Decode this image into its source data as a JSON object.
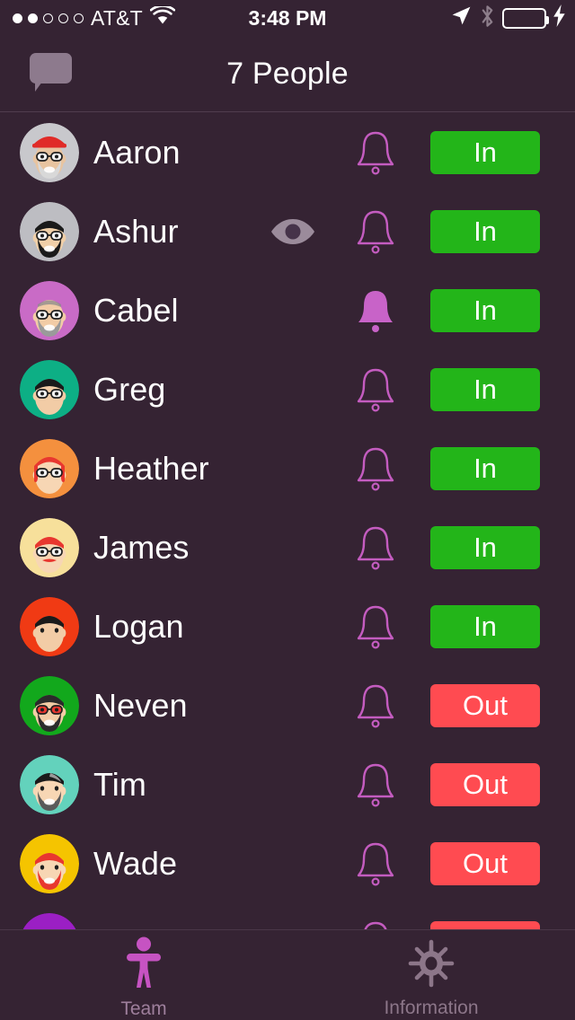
{
  "status_bar": {
    "carrier": "AT&T",
    "signal_dots_total": 5,
    "signal_dots_filled": 2,
    "wifi_icon": "wifi-icon",
    "time": "3:48 PM",
    "location_icon": "location-arrow-icon",
    "bluetooth_icon": "bluetooth-icon",
    "battery_icon": "battery-full-icon",
    "battery_color": "#4CD760",
    "charging_icon": "lightning-bolt-icon"
  },
  "nav_bar": {
    "title": "7 People",
    "left_button_icon": "chat-bubble-icon",
    "left_button_color": "#8D7A8D"
  },
  "colors": {
    "background": "#352333",
    "in_green": "#23B519",
    "out_red": "#FF4B51",
    "bell_magenta": "#C45CC0",
    "bell_filled": "#C863C8",
    "eye_gray": "#9B8B9B",
    "accent": "#C653C2",
    "inactive_tab": "#8C7689"
  },
  "list": {
    "status_in_label": "In",
    "status_out_label": "Out",
    "people": [
      {
        "name": "Aaron",
        "status": "In",
        "bell": "outline",
        "watching": false,
        "avatar": {
          "bg": "#C8C8CC",
          "hair": "#E02B28",
          "hair_style": "cap",
          "skin": "#E8C4A0",
          "beard": "#D8D8D8",
          "glasses": true
        }
      },
      {
        "name": "Ashur",
        "status": "In",
        "bell": "outline",
        "watching": true,
        "avatar": {
          "bg": "#BDBDC2",
          "hair": "#1A1A1A",
          "hair_style": "short",
          "skin": "#F0CFA8",
          "beard": "#1A1A1A",
          "glasses": true
        }
      },
      {
        "name": "Cabel",
        "status": "In",
        "bell": "filled",
        "watching": false,
        "avatar": {
          "bg": "#C96BC6",
          "hair": "#8A8A8A",
          "hair_style": "bald",
          "skin": "#F2CCA6",
          "beard": "#9A9A9A",
          "glasses": true
        }
      },
      {
        "name": "Greg",
        "status": "In",
        "bell": "outline",
        "watching": false,
        "avatar": {
          "bg": "#0DAF85",
          "hair": "#1A1A1A",
          "hair_style": "short",
          "skin": "#F2CCA6",
          "beard": "none",
          "glasses": true
        }
      },
      {
        "name": "Heather",
        "status": "In",
        "bell": "outline",
        "watching": false,
        "avatar": {
          "bg": "#F4903E",
          "hair": "#E8372F",
          "hair_style": "long",
          "skin": "#F7D6B4",
          "beard": "none",
          "glasses": true
        }
      },
      {
        "name": "James",
        "status": "In",
        "bell": "outline",
        "watching": false,
        "avatar": {
          "bg": "#F7E09B",
          "hair": "#E8372F",
          "hair_style": "short",
          "skin": "#F7D6B4",
          "beard": "mustache",
          "glasses": true
        }
      },
      {
        "name": "Logan",
        "status": "In",
        "bell": "outline",
        "watching": false,
        "avatar": {
          "bg": "#F03A14",
          "hair": "#1A1A1A",
          "hair_style": "short",
          "skin": "#F2CCA6",
          "beard": "none",
          "glasses": false
        }
      },
      {
        "name": "Neven",
        "status": "Out",
        "bell": "outline",
        "watching": false,
        "avatar": {
          "bg": "#12A81C",
          "hair": "#2B2B2B",
          "hair_style": "short",
          "skin": "#F2CCA6",
          "beard": "#2B2B2B",
          "glasses": true,
          "glasses_color": "#E8372F"
        }
      },
      {
        "name": "Tim",
        "status": "Out",
        "bell": "outline",
        "watching": false,
        "avatar": {
          "bg": "#63D2BC",
          "hair": "#1A1A1A",
          "hair_style": "streak",
          "skin": "#F7D6B4",
          "beard": "#5A5A5A",
          "glasses": false
        }
      },
      {
        "name": "Wade",
        "status": "Out",
        "bell": "outline",
        "watching": false,
        "avatar": {
          "bg": "#F5C400",
          "hair": "#E8372F",
          "hair_style": "short",
          "skin": "#F7D6B4",
          "beard": "#E8372F",
          "glasses": false
        }
      },
      {
        "name": "",
        "status": "Out",
        "bell": "outline",
        "watching": false,
        "partial": true,
        "avatar": {
          "bg": "#9B1FC4",
          "hair": "#E02B28",
          "hair_style": "short",
          "skin": "#F7D6B4",
          "beard": "none",
          "glasses": false
        }
      }
    ]
  },
  "tab_bar": {
    "tabs": [
      {
        "label": "Team",
        "icon": "person-icon",
        "active": true
      },
      {
        "label": "Information",
        "icon": "gear-icon",
        "active": false
      }
    ]
  }
}
